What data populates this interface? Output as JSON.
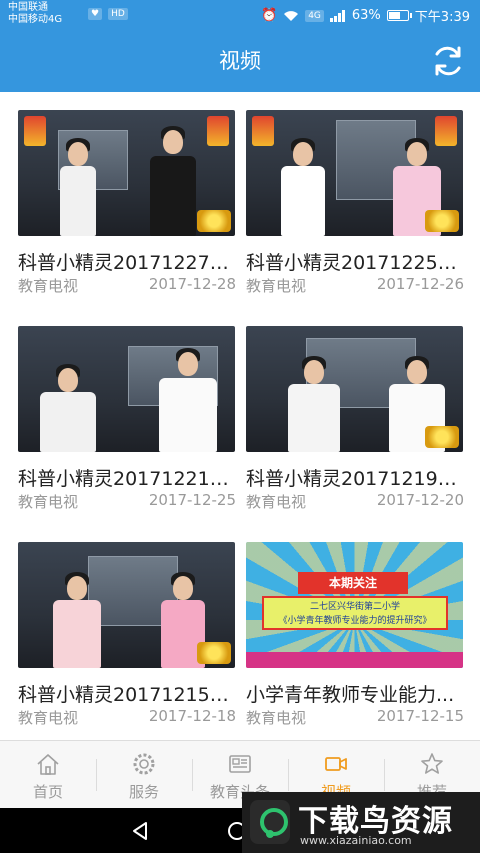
{
  "status_bar": {
    "carrier_1": "中国联通",
    "carrier_2": "中国移动4G",
    "network_badge": "4G",
    "battery_text": "63%",
    "battery_level": 0.63,
    "time": "下午3:39"
  },
  "header": {
    "title": "视频",
    "refresh_icon": "refresh-icon",
    "accent_color": "#3596de"
  },
  "videos": [
    {
      "title": "科普小精灵20171227—...",
      "source": "教育电视",
      "date": "2017-12-28"
    },
    {
      "title": "科普小精灵20171225—...",
      "source": "教育电视",
      "date": "2017-12-26"
    },
    {
      "title": "科普小精灵20171221—...",
      "source": "教育电视",
      "date": "2017-12-25"
    },
    {
      "title": "科普小精灵20171219—...",
      "source": "教育电视",
      "date": "2017-12-20"
    },
    {
      "title": "科普小精灵20171215—...",
      "source": "教育电视",
      "date": "2017-12-18"
    },
    {
      "title": "小学青年教师专业能力...",
      "source": "教育电视",
      "date": "2017-12-15"
    }
  ],
  "promo_thumb": {
    "ribbon": "本期关注",
    "line_1": "二七区兴华街第二小学",
    "line_2": "《小学青年教师专业能力的提升研究》"
  },
  "bottom_nav": {
    "active_color": "#f09c1f",
    "items": [
      {
        "label": "首页",
        "icon": "home-icon"
      },
      {
        "label": "服务",
        "icon": "gear-icon"
      },
      {
        "label": "教育头条",
        "icon": "news-icon"
      },
      {
        "label": "视频",
        "icon": "video-camera-icon"
      },
      {
        "label": "推荐",
        "icon": "star-icon"
      }
    ]
  },
  "watermark": {
    "text": "下载鸟资源",
    "url": "www.xiazainiao.com"
  }
}
